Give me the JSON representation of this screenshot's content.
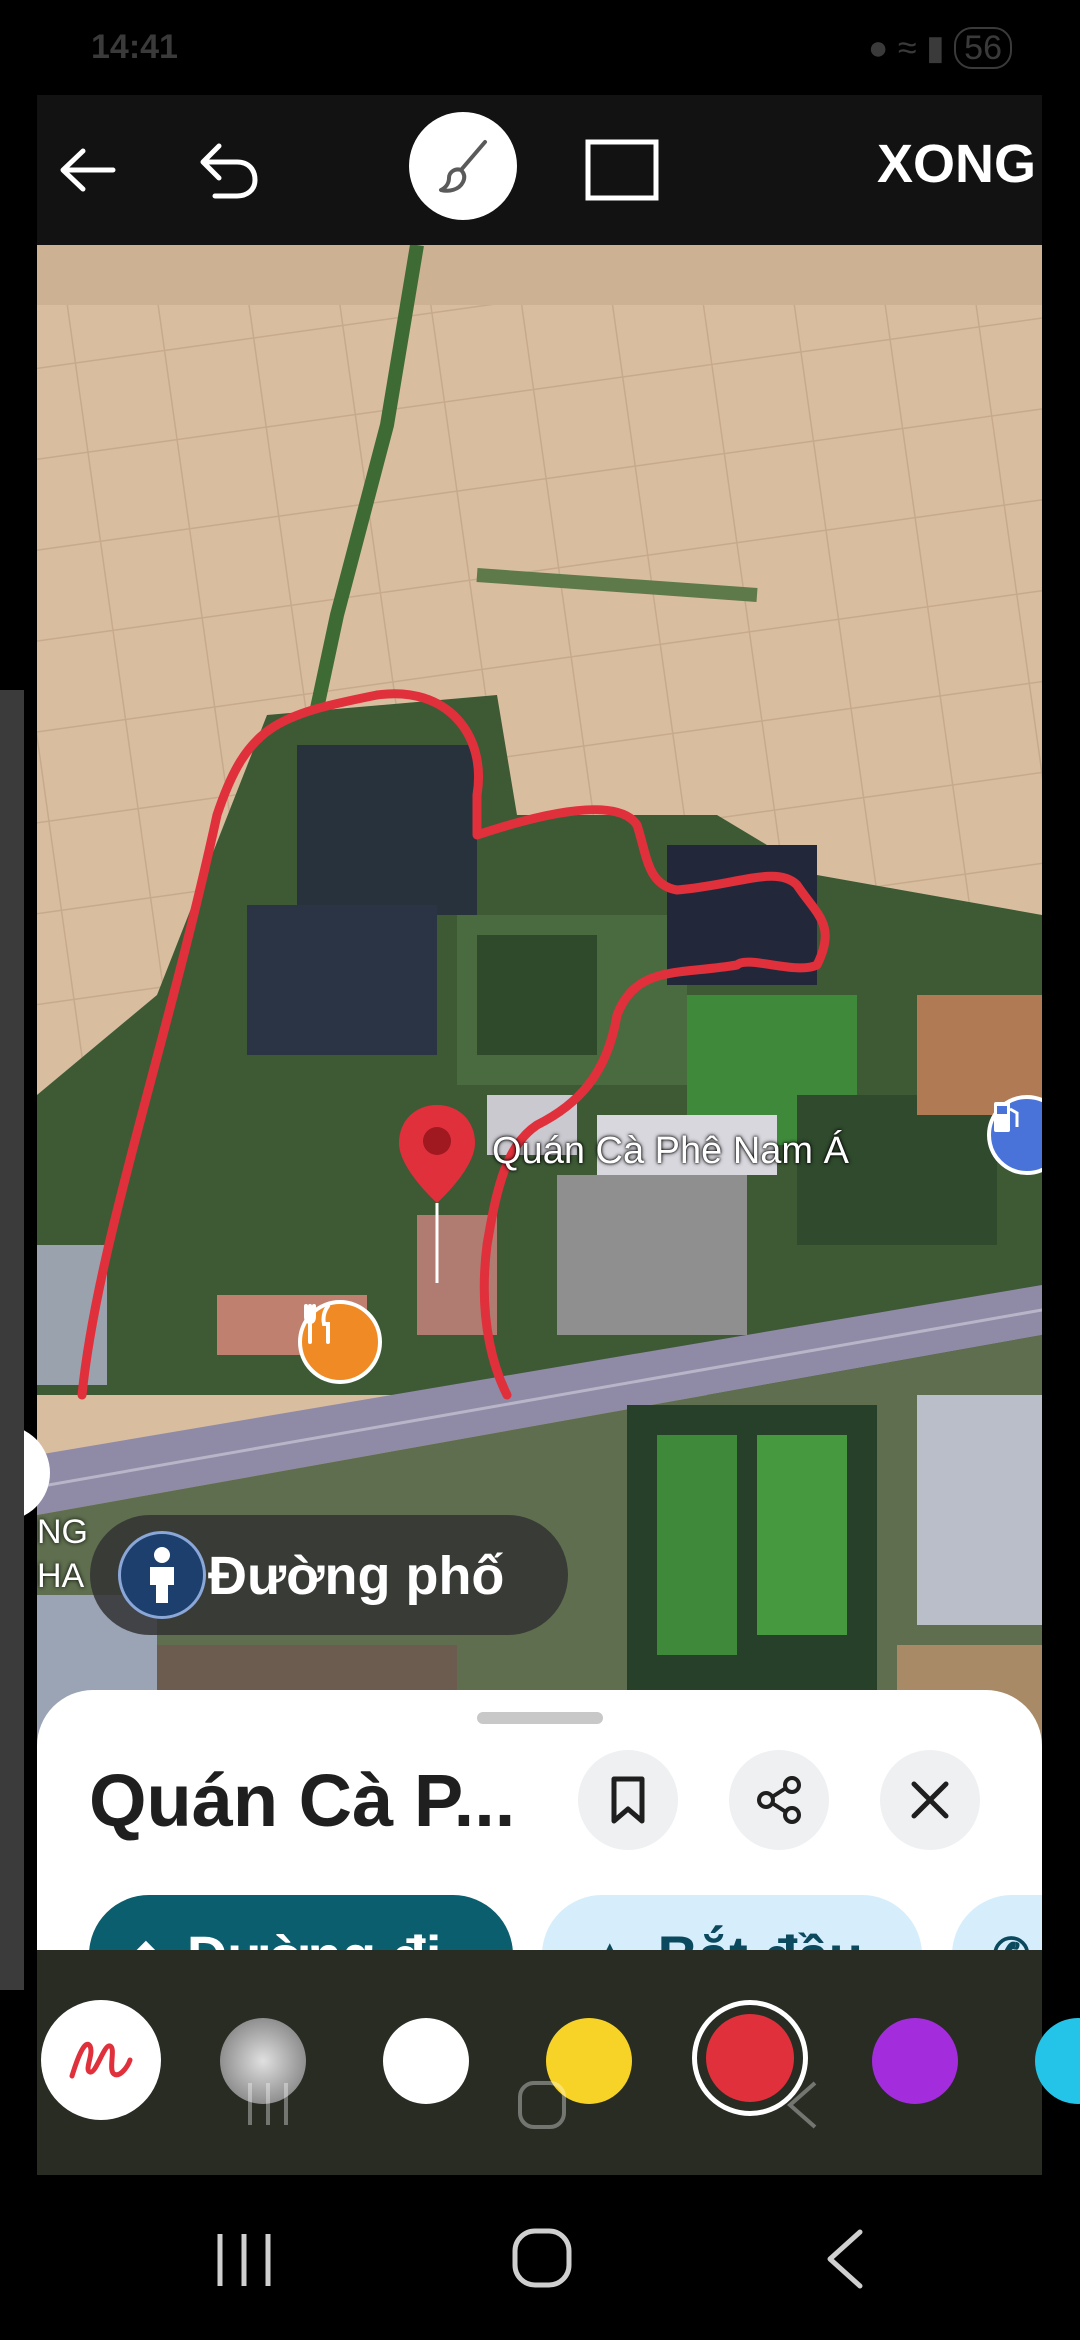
{
  "status_bar": {
    "time": "14:41",
    "battery": "56"
  },
  "toolbar": {
    "done_label": "XONG"
  },
  "map": {
    "place_label": "Quán Cà Phê Nam Á",
    "street_view_label": "Đường phố",
    "edge_label_lines": [
      "NG",
      "HA"
    ]
  },
  "place_sheet": {
    "title": "Quán Cà P...",
    "directions_label": "Đường đi",
    "start_label": "Bắt đầu"
  },
  "pen_colors": {
    "selected": "#e0303c",
    "swatches": [
      "gray-gradient",
      "#ffffff",
      "#f7d227",
      "#e0303c",
      "#a32ddc",
      "#23c4e8"
    ]
  }
}
